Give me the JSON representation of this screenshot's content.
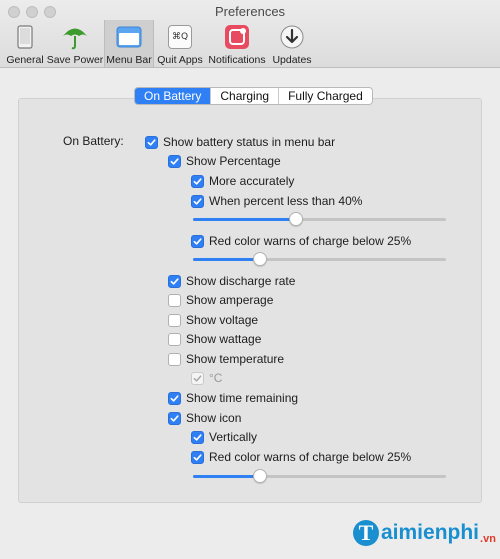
{
  "window": {
    "title": "Preferences"
  },
  "toolbar": {
    "items": [
      {
        "label": "General",
        "icon": "general-icon"
      },
      {
        "label": "Save Power",
        "icon": "umbrella-icon"
      },
      {
        "label": "Menu Bar",
        "icon": "menu-bar-icon",
        "active": true
      },
      {
        "label": "Quit Apps",
        "icon": "cmd-q-icon",
        "glyph": "⌘Q"
      },
      {
        "label": "Notifications",
        "icon": "notification-badge-icon"
      },
      {
        "label": "Updates",
        "icon": "download-icon"
      }
    ]
  },
  "tabs": {
    "items": [
      "On Battery",
      "Charging",
      "Fully Charged"
    ],
    "selected": "On Battery"
  },
  "section_label": "On Battery:",
  "options": {
    "show_battery_status": {
      "label": "Show battery status in menu bar",
      "checked": true
    },
    "show_percentage": {
      "label": "Show Percentage",
      "checked": true
    },
    "more_accurately": {
      "label": "More accurately",
      "checked": true
    },
    "when_percent_less": {
      "label": "When percent less than 40%",
      "checked": true
    },
    "red_color_warns_1": {
      "label": "Red color warns of charge below 25%",
      "checked": true
    },
    "show_discharge_rate": {
      "label": "Show discharge rate",
      "checked": true
    },
    "show_amperage": {
      "label": "Show amperage",
      "checked": false
    },
    "show_voltage": {
      "label": "Show voltage",
      "checked": false
    },
    "show_wattage": {
      "label": "Show wattage",
      "checked": false
    },
    "show_temperature": {
      "label": "Show temperature",
      "checked": false
    },
    "celsius": {
      "label": "°C",
      "checked": true,
      "disabled": true
    },
    "show_time_remaining": {
      "label": "Show time remaining",
      "checked": true
    },
    "show_icon": {
      "label": "Show icon",
      "checked": true
    },
    "vertically": {
      "label": "Vertically",
      "checked": true
    },
    "red_color_warns_2": {
      "label": "Red color warns of charge below 25%",
      "checked": true
    }
  },
  "sliders": {
    "percent_threshold": {
      "value": 40,
      "min": 0,
      "max": 100
    },
    "red_warn_1": {
      "value": 25,
      "min": 0,
      "max": 100
    },
    "red_warn_2": {
      "value": 25,
      "min": 0,
      "max": 100
    }
  },
  "watermark": {
    "initial": "T",
    "text": "aimienphi",
    "suffix": ".vn"
  },
  "colors": {
    "accent": "#2f7ff5",
    "watermark": "#1a8fd0"
  }
}
